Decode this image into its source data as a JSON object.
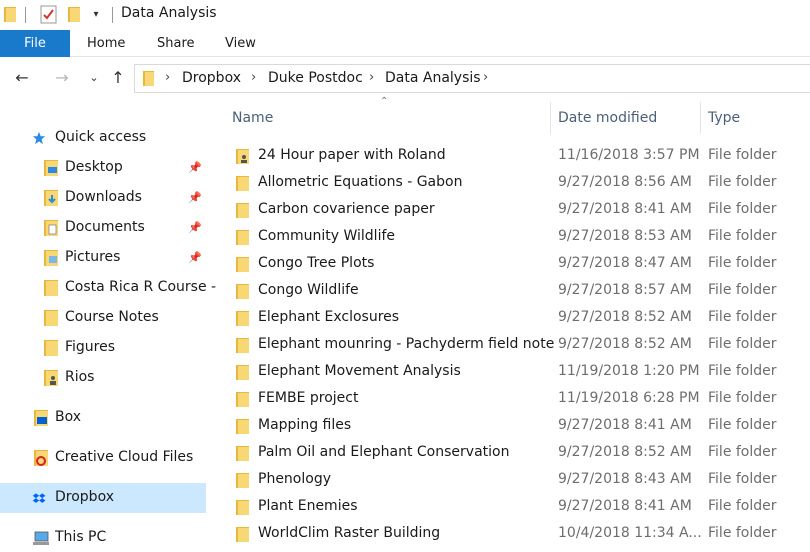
{
  "window": {
    "title": "Data Analysis"
  },
  "quick_access_toolbar": {
    "icons": [
      "folder-icon",
      "properties-icon",
      "new-folder-icon"
    ],
    "dropdown": "▾"
  },
  "ribbon": {
    "tabs": [
      "File",
      "Home",
      "Share",
      "View"
    ]
  },
  "address": {
    "crumbs": [
      "Dropbox",
      "Duke Postdoc",
      "Data Analysis"
    ],
    "separator": "›"
  },
  "nav_pane": {
    "items": [
      {
        "label": "Quick access",
        "icon": "star-icon"
      },
      {
        "label": "Desktop",
        "icon": "desktop-folder-icon",
        "pinned": true
      },
      {
        "label": "Downloads",
        "icon": "downloads-folder-icon",
        "pinned": true
      },
      {
        "label": "Documents",
        "icon": "documents-folder-icon",
        "pinned": true
      },
      {
        "label": "Pictures",
        "icon": "pictures-folder-icon",
        "pinned": true
      },
      {
        "label": "Costa Rica R Course -",
        "icon": "folder-icon"
      },
      {
        "label": "Course Notes",
        "icon": "folder-icon"
      },
      {
        "label": "Figures",
        "icon": "folder-icon"
      },
      {
        "label": "Rios",
        "icon": "shared-folder-icon"
      },
      {
        "label": "Box",
        "icon": "box-icon"
      },
      {
        "label": "Creative Cloud Files",
        "icon": "creative-cloud-icon"
      },
      {
        "label": "Dropbox",
        "icon": "dropbox-icon",
        "selected": true
      },
      {
        "label": "This PC",
        "icon": "computer-icon"
      }
    ]
  },
  "file_list": {
    "columns": [
      "Name",
      "Date modified",
      "Type"
    ],
    "sorted_by": "Name",
    "rows": [
      {
        "name": "24 Hour paper with Roland",
        "date": "11/16/2018 3:57 PM",
        "type": "File folder",
        "shared": true
      },
      {
        "name": "Allometric Equations - Gabon",
        "date": "9/27/2018 8:56 AM",
        "type": "File folder"
      },
      {
        "name": "Carbon covarience paper",
        "date": "9/27/2018 8:41 AM",
        "type": "File folder"
      },
      {
        "name": "Community Wildlife",
        "date": "9/27/2018 8:53 AM",
        "type": "File folder"
      },
      {
        "name": "Congo Tree Plots",
        "date": "9/27/2018 8:47 AM",
        "type": "File folder"
      },
      {
        "name": "Congo Wildlife",
        "date": "9/27/2018 8:57 AM",
        "type": "File folder"
      },
      {
        "name": "Elephant Exclosures",
        "date": "9/27/2018 8:52 AM",
        "type": "File folder"
      },
      {
        "name": "Elephant mounring - Pachyderm field note",
        "date": "9/27/2018 8:52 AM",
        "type": "File folder"
      },
      {
        "name": "Elephant Movement Analysis",
        "date": "11/19/2018 1:20 PM",
        "type": "File folder"
      },
      {
        "name": "FEMBE project",
        "date": "11/19/2018 6:28 PM",
        "type": "File folder"
      },
      {
        "name": "Mapping files",
        "date": "9/27/2018 8:41 AM",
        "type": "File folder"
      },
      {
        "name": "Palm Oil and Elephant Conservation",
        "date": "9/27/2018 8:52 AM",
        "type": "File folder"
      },
      {
        "name": "Phenology",
        "date": "9/27/2018 8:43 AM",
        "type": "File folder"
      },
      {
        "name": "Plant Enemies",
        "date": "9/27/2018 8:41 AM",
        "type": "File folder"
      },
      {
        "name": "WorldClim Raster Building",
        "date": "10/4/2018 11:34 A...",
        "type": "File folder"
      }
    ]
  },
  "colors": {
    "file_tab": "#1979ca",
    "selected_bg": "#cce8ff",
    "folder": "#f8d775",
    "folder_dark": "#e8b73f",
    "column_header": "#4c607a",
    "secondary_text": "#6d6d6d"
  }
}
